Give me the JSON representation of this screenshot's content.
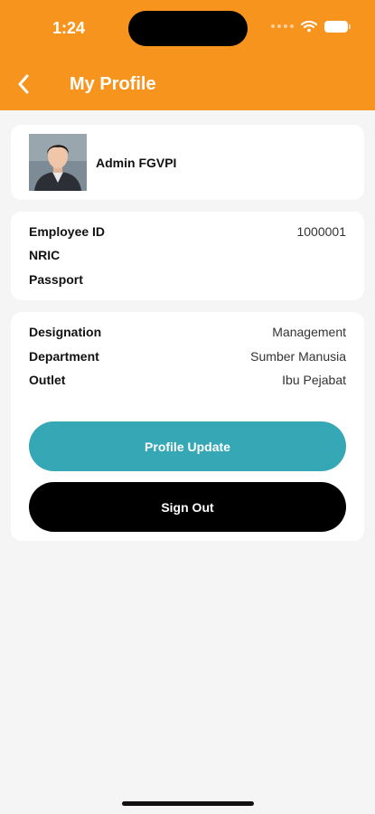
{
  "status_bar": {
    "time": "1:24"
  },
  "header": {
    "title": "My Profile",
    "back_icon": "chevron-left-icon",
    "color": "#f7941d"
  },
  "profile": {
    "name": "Admin FGVPI"
  },
  "identity": {
    "rows": [
      {
        "label": "Employee ID",
        "value": "1000001"
      },
      {
        "label": "NRIC",
        "value": ""
      },
      {
        "label": "Passport",
        "value": ""
      }
    ]
  },
  "work": {
    "rows": [
      {
        "label": "Designation",
        "value": "Management"
      },
      {
        "label": "Department",
        "value": "Sumber Manusia"
      },
      {
        "label": "Outlet",
        "value": "Ibu Pejabat"
      }
    ]
  },
  "actions": {
    "update_label": "Profile Update",
    "update_color": "#36a7b5",
    "signout_label": "Sign Out",
    "signout_color": "#000000"
  }
}
